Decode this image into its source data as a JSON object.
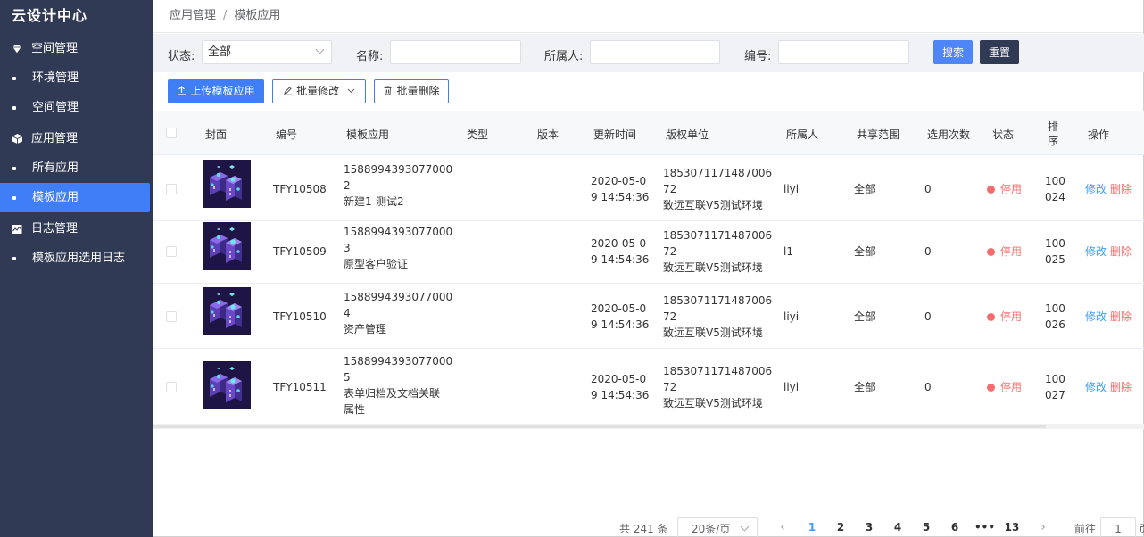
{
  "app": {
    "title": "云设计中心"
  },
  "sidebar": {
    "items": [
      {
        "type": "group",
        "label": "空间管理",
        "icon": "diamond-icon"
      },
      {
        "type": "item",
        "label": "环境管理"
      },
      {
        "type": "item",
        "label": "空间管理"
      },
      {
        "type": "group",
        "label": "应用管理",
        "icon": "cube-icon"
      },
      {
        "type": "item",
        "label": "所有应用"
      },
      {
        "type": "item",
        "label": "模板应用",
        "active": true
      },
      {
        "type": "group",
        "label": "日志管理",
        "icon": "chart-icon"
      },
      {
        "type": "item",
        "label": "模板应用选用日志"
      }
    ]
  },
  "breadcrumb": {
    "parent": "应用管理",
    "separator": "/",
    "current": "模板应用"
  },
  "filter": {
    "status_label": "状态:",
    "status_value": "全部",
    "name_label": "名称:",
    "owner_label": "所属人:",
    "code_label": "编号:",
    "search_button": "搜索",
    "reset_button": "重置"
  },
  "toolbar": {
    "upload_button": "上传模板应用",
    "batch_edit_button": "批量修改",
    "batch_delete_button": "批量删除"
  },
  "table": {
    "headers": {
      "cover": "封面",
      "code": "编号",
      "app": "模板应用",
      "type": "类型",
      "version": "版本",
      "updated": "更新时间",
      "copyright": "版权单位",
      "owner": "所属人",
      "share": "共享范围",
      "count": "选用次数",
      "status": "状态",
      "sort_1": "排",
      "sort_2": "序",
      "ops": "操作"
    },
    "rows": [
      {
        "code": "TFY10508",
        "app_l1": "1588994393077000",
        "app_l2": "2",
        "app_l3": "新建1-测试2",
        "app_l4": "",
        "updated_l1": "2020-05-0",
        "updated_l2": "9 14:54:36",
        "copy_l1": "1853071171487006",
        "copy_l2": "72",
        "copy_l3": "致远互联V5测试环境",
        "owner": "liyi",
        "share": "全部",
        "count": "0",
        "status": "停用",
        "sort_l1": "100",
        "sort_l2": "024",
        "edit": "修改",
        "delete": "删除"
      },
      {
        "code": "TFY10509",
        "app_l1": "1588994393077000",
        "app_l2": "3",
        "app_l3": "原型客户验证",
        "app_l4": "",
        "updated_l1": "2020-05-0",
        "updated_l2": "9 14:54:36",
        "copy_l1": "1853071171487006",
        "copy_l2": "72",
        "copy_l3": "致远互联V5测试环境",
        "owner": "l1",
        "share": "全部",
        "count": "0",
        "status": "停用",
        "sort_l1": "100",
        "sort_l2": "025",
        "edit": "修改",
        "delete": "删除"
      },
      {
        "code": "TFY10510",
        "app_l1": "1588994393077000",
        "app_l2": "4",
        "app_l3": "资产管理",
        "app_l4": "",
        "updated_l1": "2020-05-0",
        "updated_l2": "9 14:54:36",
        "copy_l1": "1853071171487006",
        "copy_l2": "72",
        "copy_l3": "致远互联V5测试环境",
        "owner": "liyi",
        "share": "全部",
        "count": "0",
        "status": "停用",
        "sort_l1": "100",
        "sort_l2": "026",
        "edit": "修改",
        "delete": "删除"
      },
      {
        "code": "TFY10511",
        "app_l1": "1588994393077000",
        "app_l2": "5",
        "app_l3": "表单归档及文档关联",
        "app_l4": "属性",
        "updated_l1": "2020-05-0",
        "updated_l2": "9 14:54:36",
        "copy_l1": "1853071171487006",
        "copy_l2": "72",
        "copy_l3": "致远互联V5测试环境",
        "owner": "liyi",
        "share": "全部",
        "count": "0",
        "status": "停用",
        "sort_l1": "100",
        "sort_l2": "027",
        "edit": "修改",
        "delete": "删除"
      }
    ]
  },
  "pagination": {
    "total": "共 241 条",
    "page_size": "20条/页",
    "pages": [
      "1",
      "2",
      "3",
      "4",
      "5",
      "6",
      "•••",
      "13"
    ],
    "current": "1",
    "goto_label": "前往",
    "goto_value": "1",
    "goto_suffix": "页"
  }
}
